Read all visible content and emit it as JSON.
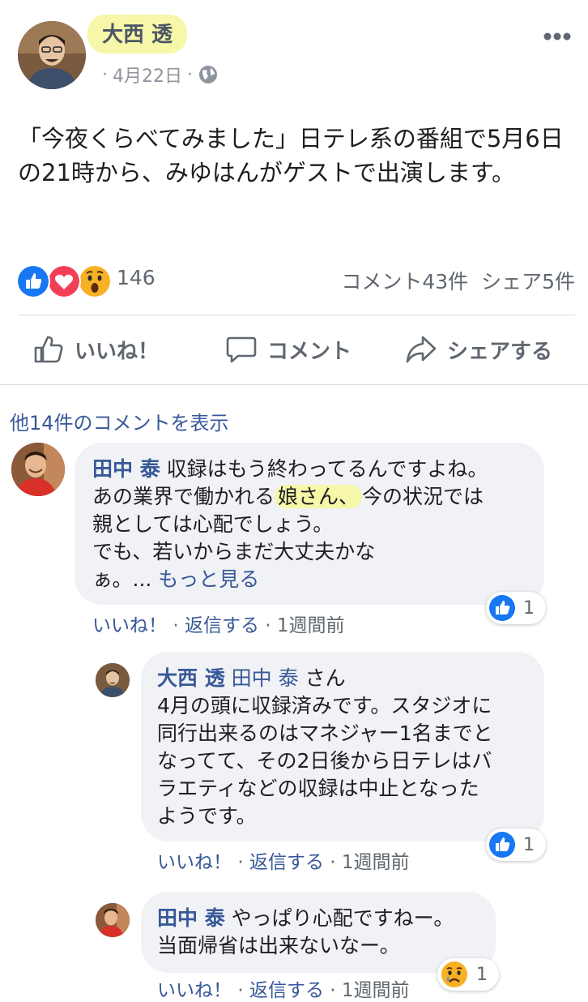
{
  "post": {
    "author": "大西 透",
    "date": "4月22日",
    "dot": "·",
    "text_line1": "「今夜くらべてみました」日テレ系の番組で5月6日",
    "text_line2": "の21時から、みゆはんがゲストで出演します。"
  },
  "reactions": {
    "count": "146",
    "comment_share": "コメント43件 シェア5件"
  },
  "actions": {
    "like": "いいね！",
    "comment": "コメント",
    "share": "シェアする"
  },
  "more_comments": "他14件のコメントを表示",
  "comments": [
    {
      "author": "田中 泰",
      "l1": "収録はもう終わってるんですよね。",
      "l2a": "あの業界で働かれる",
      "l2mark": "娘さん、",
      "l2b": "今の状況では",
      "l3": "親としては心配でしょう。",
      "l4": "でも、若いからまだ大丈夫かな",
      "l5": "ぁ。...",
      "see_more": "もっと見る",
      "like": "いいね！",
      "reply": "返信する",
      "time": "1週間前",
      "sep": "·",
      "reaction_count": "1"
    },
    {
      "author": "大西 透",
      "mention": "田中 泰",
      "suffix": "さん",
      "l1": "4月の頭に収録済みです。スタジオに",
      "l2": "同行出来るのはマネジャー1名までと",
      "l3": "なってて、その2日後から日テレはバ",
      "l4": "ラエティなどの収録は中止となった",
      "l5": "ようです。",
      "like": "いいね！",
      "reply": "返信する",
      "time": "1週間前",
      "sep": "·",
      "reaction_count": "1"
    },
    {
      "author": "田中 泰",
      "l1": "やっぱり心配ですねー。",
      "l2": "当面帰省は出来ないなー。",
      "like": "いいね！",
      "reply": "返信する",
      "time": "1週間前",
      "sep": "·",
      "reaction_count": "1"
    }
  ],
  "colors": {
    "link_blue": "#385898",
    "like_blue": "#1877f2",
    "love_red": "#f33e58",
    "wow_yellow": "#f7b125",
    "highlight": "#f6f7a8",
    "bubble": "#f0f2f5"
  },
  "icons": [
    "globe-icon",
    "more-icon",
    "like-reaction-icon",
    "love-reaction-icon",
    "wow-reaction-icon",
    "thumbs-up-icon",
    "comment-icon",
    "share-icon",
    "sad-reaction-icon"
  ]
}
